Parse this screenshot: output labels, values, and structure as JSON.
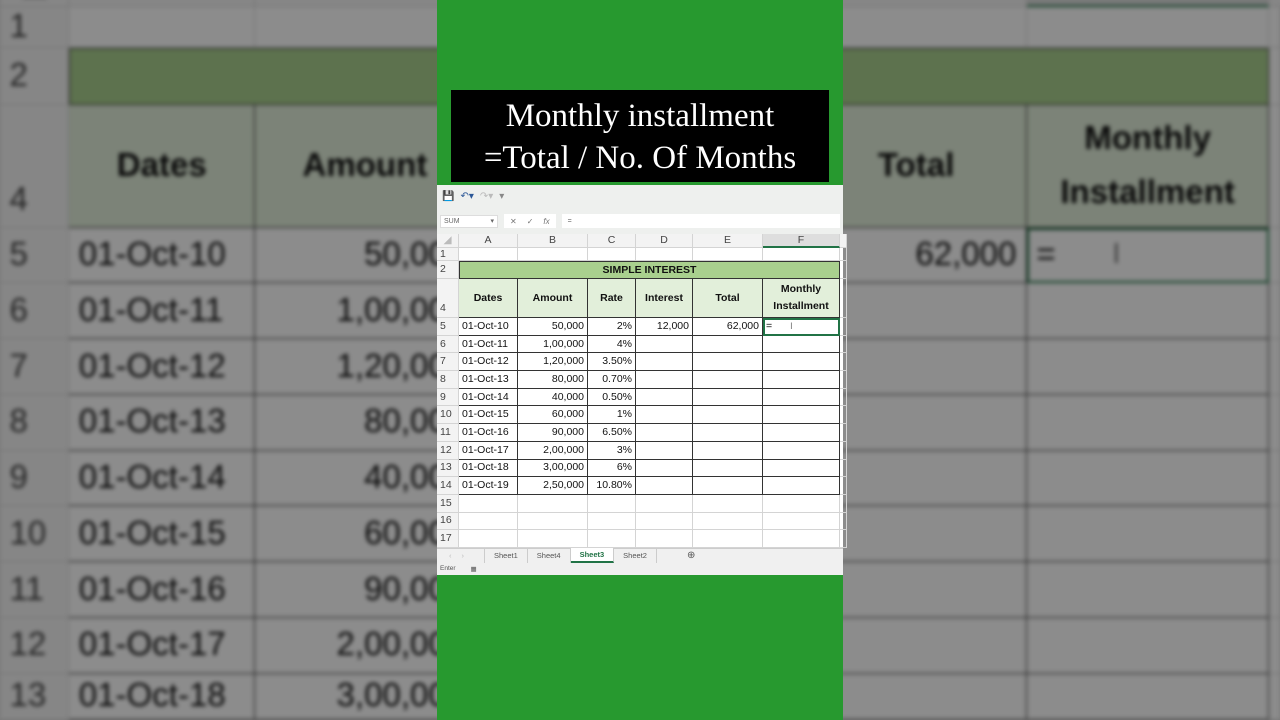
{
  "caption": {
    "line1": "Monthly installment",
    "line2": "=Total / No. Of Months"
  },
  "formula_bar": {
    "name_box": "SUM",
    "value": "="
  },
  "columns": [
    "A",
    "B",
    "C",
    "D",
    "E",
    "F"
  ],
  "title": "SIMPLE INTEREST",
  "headers": [
    "Dates",
    "Amount",
    "Rate",
    "Interest",
    "Total",
    "Monthly Installment"
  ],
  "rows": [
    {
      "n": "5",
      "date": "01-Oct-10",
      "amount": "50,000",
      "rate": "2%",
      "interest": "12,000",
      "total": "62,000",
      "monthly": "="
    },
    {
      "n": "6",
      "date": "01-Oct-11",
      "amount": "1,00,000",
      "rate": "4%"
    },
    {
      "n": "7",
      "date": "01-Oct-12",
      "amount": "1,20,000",
      "rate": "3.50%"
    },
    {
      "n": "8",
      "date": "01-Oct-13",
      "amount": "80,000",
      "rate": "0.70%"
    },
    {
      "n": "9",
      "date": "01-Oct-14",
      "amount": "40,000",
      "rate": "0.50%"
    },
    {
      "n": "10",
      "date": "01-Oct-15",
      "amount": "60,000",
      "rate": "1%"
    },
    {
      "n": "11",
      "date": "01-Oct-16",
      "amount": "90,000",
      "rate": "6.50%"
    },
    {
      "n": "12",
      "date": "01-Oct-17",
      "amount": "2,00,000",
      "rate": "3%"
    },
    {
      "n": "13",
      "date": "01-Oct-18",
      "amount": "3,00,000",
      "rate": "6%"
    },
    {
      "n": "14",
      "date": "01-Oct-19",
      "amount": "2,50,000",
      "rate": "10.80%"
    }
  ],
  "empty_rows": [
    "15",
    "16",
    "17"
  ],
  "row_labels": {
    "r1": "1",
    "r2": "2",
    "r4": "4"
  },
  "sheets": [
    {
      "label": "Sheet1"
    },
    {
      "label": "Sheet4"
    },
    {
      "label": "Sheet3",
      "active": true
    },
    {
      "label": "Sheet2"
    }
  ],
  "status": {
    "mode": "Enter"
  }
}
